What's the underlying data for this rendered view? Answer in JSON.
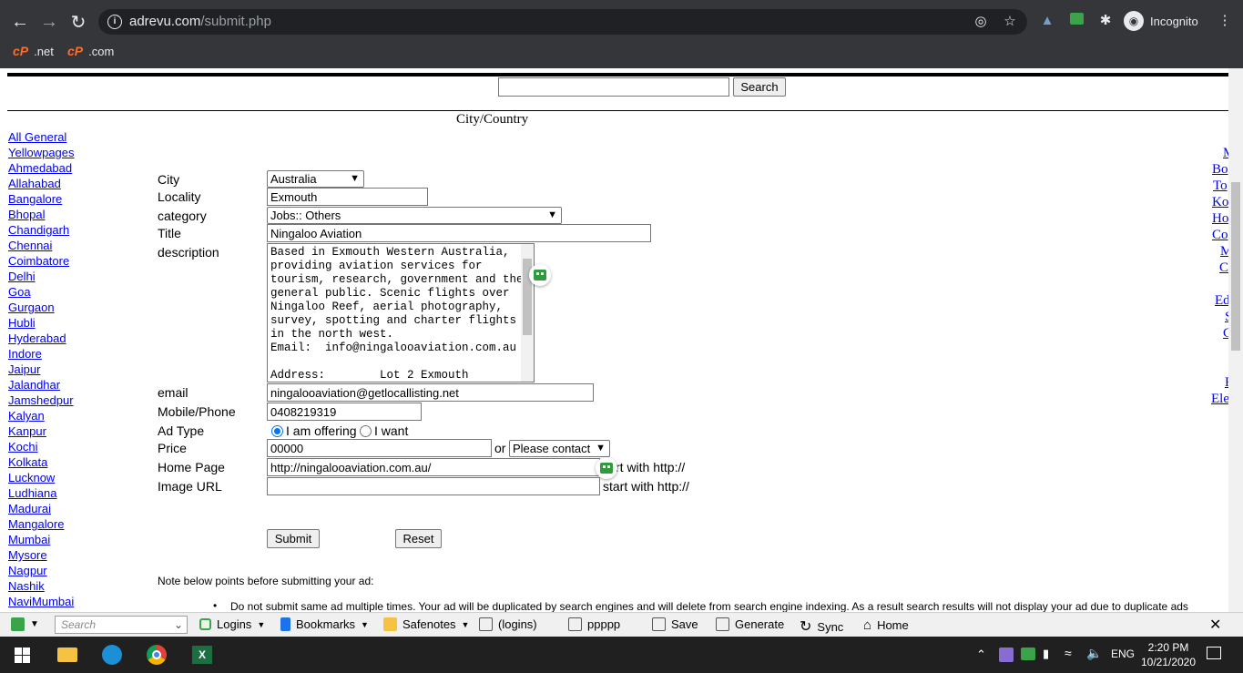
{
  "browser": {
    "url_host": "adrevu.com",
    "url_path": "/submit.php",
    "profile_label": "Incognito",
    "bookmarks": [
      ".net",
      ".com"
    ]
  },
  "header": {
    "search_button": "Search",
    "section_title": "City/Country"
  },
  "sidebar": {
    "links": [
      "All General",
      "Yellowpages",
      "Ahmedabad",
      "Allahabad",
      "Bangalore",
      "Bhopal",
      "Chandigarh",
      "Chennai",
      "Coimbatore",
      "Delhi",
      "Goa",
      "Gurgaon",
      "Hubli",
      "Hyderabad",
      "Indore",
      "Jaipur",
      "Jalandhar",
      "Jamshedpur",
      "Kalyan",
      "Kanpur",
      "Kochi",
      "Kolkata",
      "Lucknow",
      "Ludhiana",
      "Madurai",
      "Mangalore",
      "Mumbai",
      "Mysore",
      "Nagpur",
      "Nashik",
      "NaviMumbai"
    ]
  },
  "right_sidebar": {
    "fragments": [
      "M",
      "Bo",
      "To",
      "Ko",
      "Ho",
      "Co",
      "M",
      "C",
      "",
      "Ed",
      "S",
      "C",
      "",
      "",
      "F",
      "Ele"
    ]
  },
  "form": {
    "city_label": "City",
    "city_value": "Australia",
    "locality_label": "Locality",
    "locality_value": "Exmouth",
    "category_label": "category",
    "category_value": "Jobs:: Others",
    "title_label": "Title",
    "title_value": "Ningaloo Aviation",
    "description_label": "description",
    "description_value": "Based in Exmouth Western Australia,\nproviding aviation services for\ntourism, research, government and the\ngeneral public. Scenic flights over\nNingaloo Reef, aerial photography,\nsurvey, spotting and charter flights\nin the north west.\nEmail:  info@ningalooaviation.com.au\n\nAddress:        Lot 2 Exmouth",
    "email_label": "email",
    "email_value": "ningalooaviation@getlocallisting.net",
    "phone_label": "Mobile/Phone",
    "phone_value": "0408219319",
    "adtype_label": "Ad Type",
    "adtype_offering": "I am offering",
    "adtype_want": "I want",
    "price_label": "Price",
    "price_value": "00000",
    "price_or": "or",
    "price_select": "Please contact",
    "homepage_label": "Home Page",
    "homepage_value": "http://ningalooaviation.com.au/",
    "homepage_hint": "start with http://",
    "homepage_hint_visible": "rt with http://",
    "image_label": "Image URL",
    "image_value": "",
    "image_hint": "start with http://",
    "submit_label": "Submit",
    "reset_label": "Reset"
  },
  "notes": {
    "heading": "Note below points before submitting your ad:",
    "items": [
      "Do not submit same ad multiple times. Your ad will be duplicated by search engines and will delete from search engine indexing. As a result search results will not display your ad due to duplicate ads"
    ]
  },
  "roboform": {
    "search_placeholder": "Search",
    "items": [
      "Logins",
      "Bookmarks",
      "Safenotes",
      "(logins)",
      "ppppp",
      "Save",
      "Generate",
      "Sync",
      "Home"
    ]
  },
  "taskbar": {
    "lang": "ENG",
    "time": "2:20 PM",
    "date": "10/21/2020"
  },
  "colors": {
    "chrome_bg": "#35363a",
    "omnibox_bg": "#202124",
    "link": "#0000ee",
    "taskbar_bg": "#202020"
  }
}
